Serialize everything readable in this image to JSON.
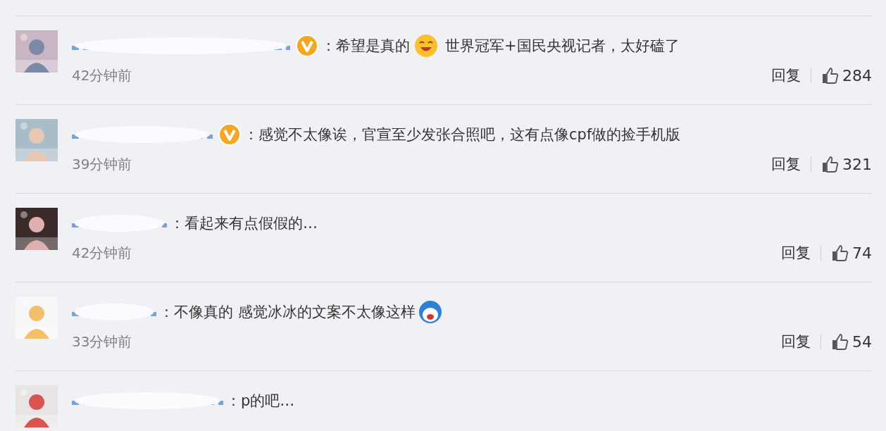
{
  "comments": [
    {
      "verified": true,
      "parts": [
        {
          "kind": "text",
          "text": "：希望是真的"
        },
        {
          "kind": "emoji"
        },
        {
          "kind": "text",
          "text": "世界冠军+国民央视记者，太好磕了"
        }
      ],
      "time": "42分钟前",
      "reply": "回复",
      "likes": "284"
    },
    {
      "verified": true,
      "parts": [
        {
          "kind": "text",
          "text": "：感觉不太像诶，官宣至少发张合照吧，这有点像cpf做的捡手机版"
        }
      ],
      "time": "39分钟前",
      "reply": "回复",
      "likes": "321"
    },
    {
      "verified": false,
      "parts": [
        {
          "kind": "text",
          "text": "：看起来有点假假的…"
        }
      ],
      "time": "42分钟前",
      "reply": "回复",
      "likes": "74"
    },
    {
      "verified": false,
      "parts": [
        {
          "kind": "text",
          "text": "：不像真的 感觉冰冰的文案不太像这样"
        },
        {
          "kind": "sticker"
        }
      ],
      "time": "33分钟前",
      "reply": "回复",
      "likes": "54"
    },
    {
      "verified": false,
      "parts": [
        {
          "kind": "text",
          "text": "：p的吧…"
        }
      ]
    }
  ]
}
